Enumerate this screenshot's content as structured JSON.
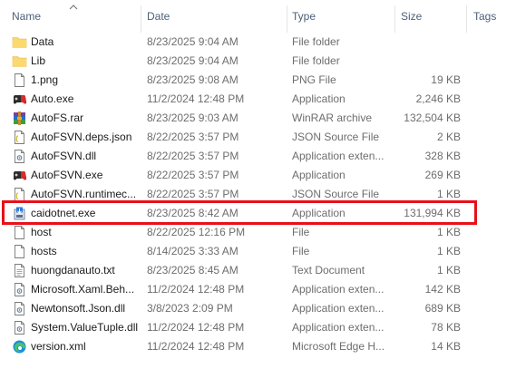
{
  "columns": {
    "name": "Name",
    "date": "Date",
    "type": "Type",
    "size": "Size",
    "tags": "Tags"
  },
  "files": [
    {
      "name": "Data",
      "date": "8/23/2025 9:04 AM",
      "type": "File folder",
      "size": "",
      "icon": "folder-icon"
    },
    {
      "name": "Lib",
      "date": "8/23/2025 9:04 AM",
      "type": "File folder",
      "size": "",
      "icon": "folder-icon"
    },
    {
      "name": "1.png",
      "date": "8/23/2025 9:08 AM",
      "type": "PNG File",
      "size": "19 KB",
      "icon": "file-icon"
    },
    {
      "name": "Auto.exe",
      "date": "11/2/2024 12:48 PM",
      "type": "Application",
      "size": "2,246 KB",
      "icon": "gamepad-icon"
    },
    {
      "name": "AutoFS.rar",
      "date": "8/23/2025 9:03 AM",
      "type": "WinRAR archive",
      "size": "132,504 KB",
      "icon": "winrar-icon"
    },
    {
      "name": "AutoFSVN.deps.json",
      "date": "8/22/2025 3:57 PM",
      "type": "JSON Source File",
      "size": "2 KB",
      "icon": "json-file-icon"
    },
    {
      "name": "AutoFSVN.dll",
      "date": "8/22/2025 3:57 PM",
      "type": "Application exten...",
      "size": "328 KB",
      "icon": "dll-file-icon"
    },
    {
      "name": "AutoFSVN.exe",
      "date": "8/22/2025 3:57 PM",
      "type": "Application",
      "size": "269 KB",
      "icon": "gamepad-icon"
    },
    {
      "name": "AutoFSVN.runtimec...",
      "date": "8/22/2025 3:57 PM",
      "type": "JSON Source File",
      "size": "1 KB",
      "icon": "json-file-icon"
    },
    {
      "name": "caidotnet.exe",
      "date": "8/23/2025 8:42 AM",
      "type": "Application",
      "size": "131,994 KB",
      "icon": "installer-icon"
    },
    {
      "name": "host",
      "date": "8/22/2025 12:16 PM",
      "type": "File",
      "size": "1 KB",
      "icon": "file-icon"
    },
    {
      "name": "hosts",
      "date": "8/14/2025 3:33 AM",
      "type": "File",
      "size": "1 KB",
      "icon": "file-icon"
    },
    {
      "name": "huongdanauto.txt",
      "date": "8/23/2025 8:45 AM",
      "type": "Text Document",
      "size": "1 KB",
      "icon": "text-file-icon"
    },
    {
      "name": "Microsoft.Xaml.Beh...",
      "date": "11/2/2024 12:48 PM",
      "type": "Application exten...",
      "size": "142 KB",
      "icon": "dll-file-icon"
    },
    {
      "name": "Newtonsoft.Json.dll",
      "date": "3/8/2023 2:09 PM",
      "type": "Application exten...",
      "size": "689 KB",
      "icon": "dll-file-icon"
    },
    {
      "name": "System.ValueTuple.dll",
      "date": "11/2/2024 12:48 PM",
      "type": "Application exten...",
      "size": "78 KB",
      "icon": "dll-file-icon"
    },
    {
      "name": "version.xml",
      "date": "11/2/2024 12:48 PM",
      "type": "Microsoft Edge H...",
      "size": "14 KB",
      "icon": "edge-icon"
    }
  ],
  "highlight_color": "#e8101a",
  "folder_color": "#f8d775"
}
